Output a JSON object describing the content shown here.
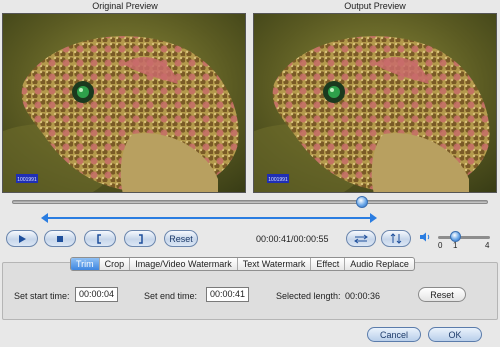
{
  "previews": {
    "original_title": "Original Preview",
    "output_title": "Output Preview",
    "watermark_text": "1001991"
  },
  "playback": {
    "seek_position": 0.73,
    "time_display": "00:00:41/00:00:55",
    "reset_label": "Reset",
    "controls": [
      "play-icon",
      "stop-icon",
      "mark-in-icon",
      "mark-out-icon"
    ],
    "aspect_icons": [
      "horizontal-arrows-icon",
      "vertical-arrows-icon"
    ]
  },
  "volume": {
    "icon": "speaker-icon",
    "min_label": "0",
    "mid_label": "1",
    "max_label": "4",
    "value": 1
  },
  "tabs": [
    {
      "label": "Trim",
      "active": true
    },
    {
      "label": "Crop",
      "active": false
    },
    {
      "label": "Image/Video Watermark",
      "active": false
    },
    {
      "label": "Text Watermark",
      "active": false
    },
    {
      "label": "Effect",
      "active": false
    },
    {
      "label": "Audio Replace",
      "active": false
    }
  ],
  "trim": {
    "start_label": "Set start time:",
    "start_value": "00:00:04",
    "end_label": "Set end time:",
    "end_value": "00:00:41",
    "selected_label": "Selected length:",
    "selected_value": "00:00:36",
    "reset_label": "Reset"
  },
  "footer": {
    "cancel_label": "Cancel",
    "ok_label": "OK"
  },
  "colors": {
    "accent": "#2a7de1",
    "tab_active": "#3e86e0"
  }
}
